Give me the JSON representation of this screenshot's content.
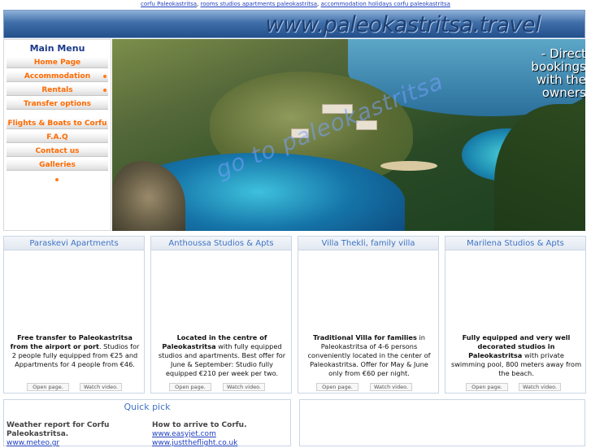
{
  "top_links": [
    "corfu Paleokastritsa",
    "rooms studios apartments paleokastritsa",
    "accommodation holidays corfu paleokastritsa"
  ],
  "banner": {
    "title": "www.paleokastritsa.travel"
  },
  "menu": {
    "title": "Main Menu",
    "items": [
      {
        "label": "Home Page",
        "has_arrow": false
      },
      {
        "label": "Accommodation",
        "has_arrow": true
      },
      {
        "label": "Rentals",
        "has_arrow": true
      },
      {
        "label": "Transfer options",
        "has_arrow": false
      },
      {
        "label": "Flights & Boats to Corfu",
        "has_arrow": false
      },
      {
        "label": "F.A.Q",
        "has_arrow": false
      },
      {
        "label": "Contact us",
        "has_arrow": false
      },
      {
        "label": "Galleries",
        "has_arrow": false
      }
    ]
  },
  "hero": {
    "tagline_line1": "- Direct bookings",
    "tagline_line2": "with the owners",
    "overlay": "go to paleokastritsa"
  },
  "cards": [
    {
      "title": "Paraskevi Apartments",
      "text_bold": "Free transfer to Paleokastritsa from the airport or port",
      "text": ". Studios for 2 people fully equipped from €25 and Appartments for 4 people from €46.",
      "btn_open": "Open page.",
      "btn_video": "Watch video."
    },
    {
      "title": "Anthoussa Studios & Apts",
      "text_bold": "Located in the centre of Paleokastritsa",
      "text": " with fully equipped studios and apartments. Best offer for June & September: Studio fully equipped €210 per week per two.",
      "btn_open": "Open page.",
      "btn_video": "Watch video."
    },
    {
      "title": "Villa Thekli, family villa",
      "text_bold": "Traditional Villa for families",
      "text": " in Paleokastritsa of 4-6 persons conveniently located in the center of Paleokastritsa. Offer for May & June only from €60 per night.",
      "btn_open": "Open page.",
      "btn_video": "Watch video."
    },
    {
      "title": "Marilena Studios & Apts",
      "text_bold": "Fully equipped and very well decorated studios in Paleokastritsa",
      "text": " with private swimming pool, 800 meters away from the beach.",
      "btn_open": "Open page.",
      "btn_video": "Watch video."
    }
  ],
  "quick_pick": {
    "title": "Quick pick",
    "weather_label": "Weather report for Corfu Paleokastritsa.",
    "weather_link": "www.meteo.gr",
    "arrive_label": "How to arrive to Corfu.",
    "arrive_links": [
      "www.easyjet.com",
      "www.justtheflight.co.uk"
    ]
  },
  "colors": {
    "menu_text": "#ff6a00",
    "card_title": "#3d73c4",
    "menu_title": "#1a3a8a"
  }
}
